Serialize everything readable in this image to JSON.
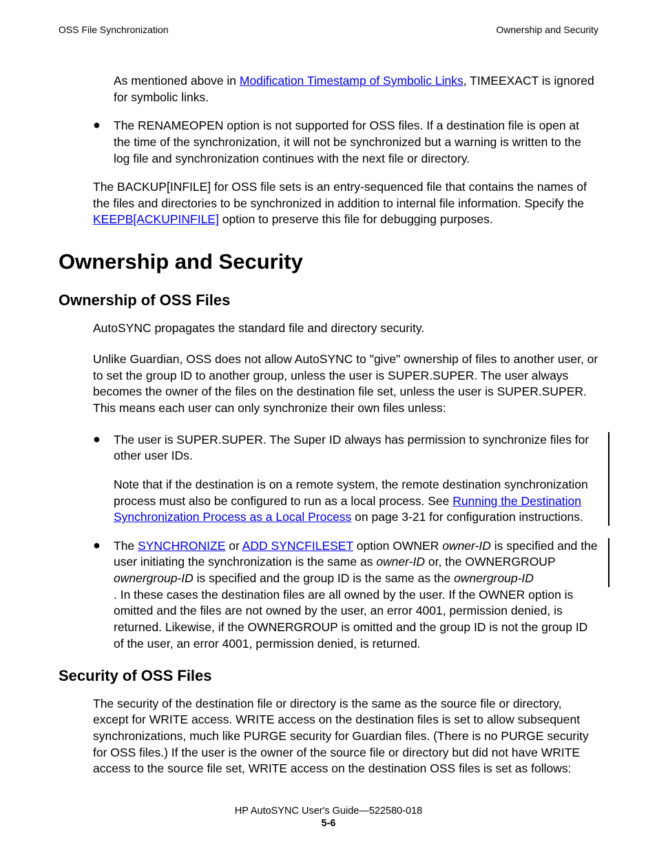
{
  "header": {
    "left": "OSS File Synchronization",
    "right": "Ownership and Security"
  },
  "p1": {
    "pre": "As mentioned above in ",
    "link": "Modification Timestamp of Symbolic Links",
    "post": ", TIMEEXACT is ignored for symbolic links."
  },
  "b1": "The RENAMEOPEN option is not supported for OSS files. If a destination file is open at the time of the synchronization, it will not be synchronized but a warning is written to the log file and synchronization continues with the next file or directory.",
  "p2": {
    "pre": "The BACKUP[INFILE] for OSS file sets is an entry-sequenced file that contains the names of the files and directories to be synchronized in addition to internal file information. Specify the ",
    "link": "KEEPB[ACKUPINFILE]",
    "post": " option to preserve this file for debugging purposes."
  },
  "h1": "Ownership and Security",
  "h2a": "Ownership of OSS Files",
  "p3": "AutoSYNC propagates the standard file and directory security.",
  "p4": "Unlike Guardian, OSS does not allow AutoSYNC to \"give\" ownership of files to another user, or to set the group ID to another group, unless the user is SUPER.SUPER. The user always becomes the owner of the files on the destination file set, unless the user is SUPER.SUPER. This means each user can only synchronize their own files unless:",
  "b2": {
    "t1": "The user is SUPER.SUPER. The Super ID always has permission to synchronize files for other user IDs.",
    "t2pre": "Note that if the destination is on a remote system, the remote destination synchronization process must also be configured to run as a local process. See ",
    "t2link": "Running the Destination Synchronization Process as a Local Process",
    "t2post": " on page 3-21 for configuration instructions."
  },
  "b3": {
    "pre": "The ",
    "l1": "SYNCHRONIZE",
    "mid1": " or ",
    "l2": "ADD SYNCFILESET",
    "mid2": " option OWNER ",
    "i1": "owner-ID",
    "mid3": " is specified and the user initiating the synchronization is the same as ",
    "i2": "owner-ID",
    "mid4": " or, the OWNERGROUP ",
    "i3": "ownergroup-ID",
    "mid5": " is specified and the group ID is the same as the ",
    "i4": "ownergroup-ID",
    "post": ". In these cases the destination files are all owned by the user. If the OWNER option is omitted and the files are not owned by the user, an error 4001, permission denied, is returned. Likewise, if the OWNERGROUP is omitted and the group ID is not the group ID of the user, an error 4001, permission denied, is returned."
  },
  "h2b": "Security of OSS Files",
  "p5": "The security of the destination file or directory is the same as the source file or directory, except for WRITE access. WRITE access on the destination files is set to allow subsequent synchronizations, much like PURGE security for Guardian files. (There is no PURGE security for OSS files.) If the user is the owner of the source file or directory but did not have WRITE access to the source file set, WRITE access on the destination OSS files is set as follows:",
  "footer": {
    "l1a": "HP AutoSYNC User's Guide",
    "l1b": "—",
    "l1c": "522580-018",
    "l2": "5-6"
  }
}
